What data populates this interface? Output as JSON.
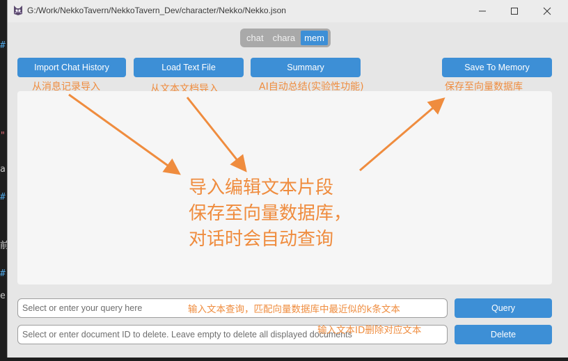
{
  "window": {
    "title": "G:/Work/NekkoTavern/NekkoTavern_Dev/character/Nekko/Nekko.json"
  },
  "tabs": [
    {
      "label": "chat",
      "active": false
    },
    {
      "label": "chara",
      "active": false
    },
    {
      "label": "mem",
      "active": true
    }
  ],
  "toolbar": {
    "import_chat_label": "Import Chat History",
    "load_text_label": "Load Text File",
    "summary_label": "Summary",
    "save_memory_label": "Save To Memory"
  },
  "annotations": {
    "import_chat": "从消息记录导入",
    "load_text": "从文本文档导入",
    "summary": "AI自动总结(实验性功能)",
    "save_memory": "保存至向量数据库",
    "center_line1": "导入编辑文本片段",
    "center_line2": "保存至向量数据库，",
    "center_line3": "对话时会自动查询",
    "query_hint": "输入文本查询，匹配向量数据库中最近似的k条文本",
    "delete_hint": "输入文本ID删除对应文本"
  },
  "query": {
    "placeholder": "Select or enter your query here",
    "value": "",
    "button_label": "Query"
  },
  "delete": {
    "placeholder": "Select or enter document ID to delete. Leave empty to delete all displayed documents",
    "value": "",
    "button_label": "Delete"
  },
  "colors": {
    "accent": "#3d8fd6",
    "annotation": "#ef8c3e",
    "window_bg": "#e6e6e6"
  },
  "icons": [
    "app-icon",
    "minimize-icon",
    "maximize-icon",
    "close-icon"
  ]
}
